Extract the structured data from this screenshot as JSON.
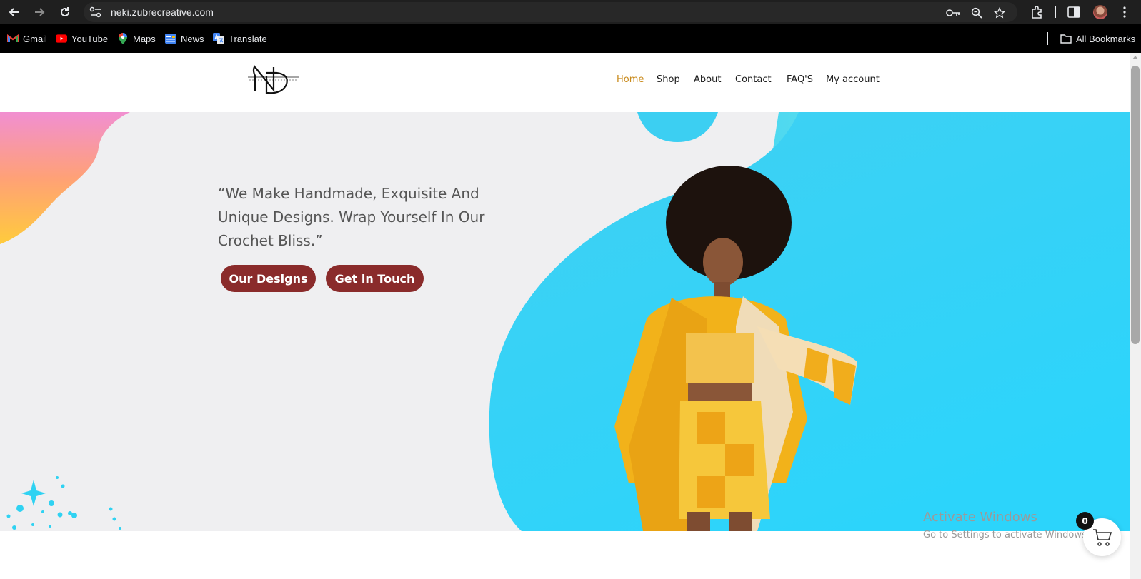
{
  "browser": {
    "url": "neki.zubrecreative.com",
    "bookmarks": [
      {
        "label": "Gmail",
        "icon": "gmail-icon"
      },
      {
        "label": "YouTube",
        "icon": "youtube-icon"
      },
      {
        "label": "Maps",
        "icon": "maps-icon"
      },
      {
        "label": "News",
        "icon": "news-icon"
      },
      {
        "label": "Translate",
        "icon": "translate-icon"
      }
    ],
    "all_bookmarks_label": "All Bookmarks"
  },
  "site": {
    "nav": [
      {
        "label": "Home",
        "active": true
      },
      {
        "label": "Shop"
      },
      {
        "label": "About"
      },
      {
        "label": "Contact"
      },
      {
        "label": "FAQ'S"
      },
      {
        "label": "My account"
      }
    ],
    "hero": {
      "quote": "“We Make Handmade, Exquisite And Unique Designs. Wrap Yourself In Our Crochet Bliss.”",
      "buttons": [
        "Our Designs",
        "Get in Touch"
      ]
    }
  },
  "overlay": {
    "activate_title": "Activate Windows",
    "activate_sub": "Go to Settings to activate Windows.",
    "cart_count": "0"
  },
  "colors": {
    "accent": "#c98a1b",
    "button": "#8a2b2b",
    "hero_bg": "#efeff1",
    "blob_cyan": "#2fd2f2"
  }
}
